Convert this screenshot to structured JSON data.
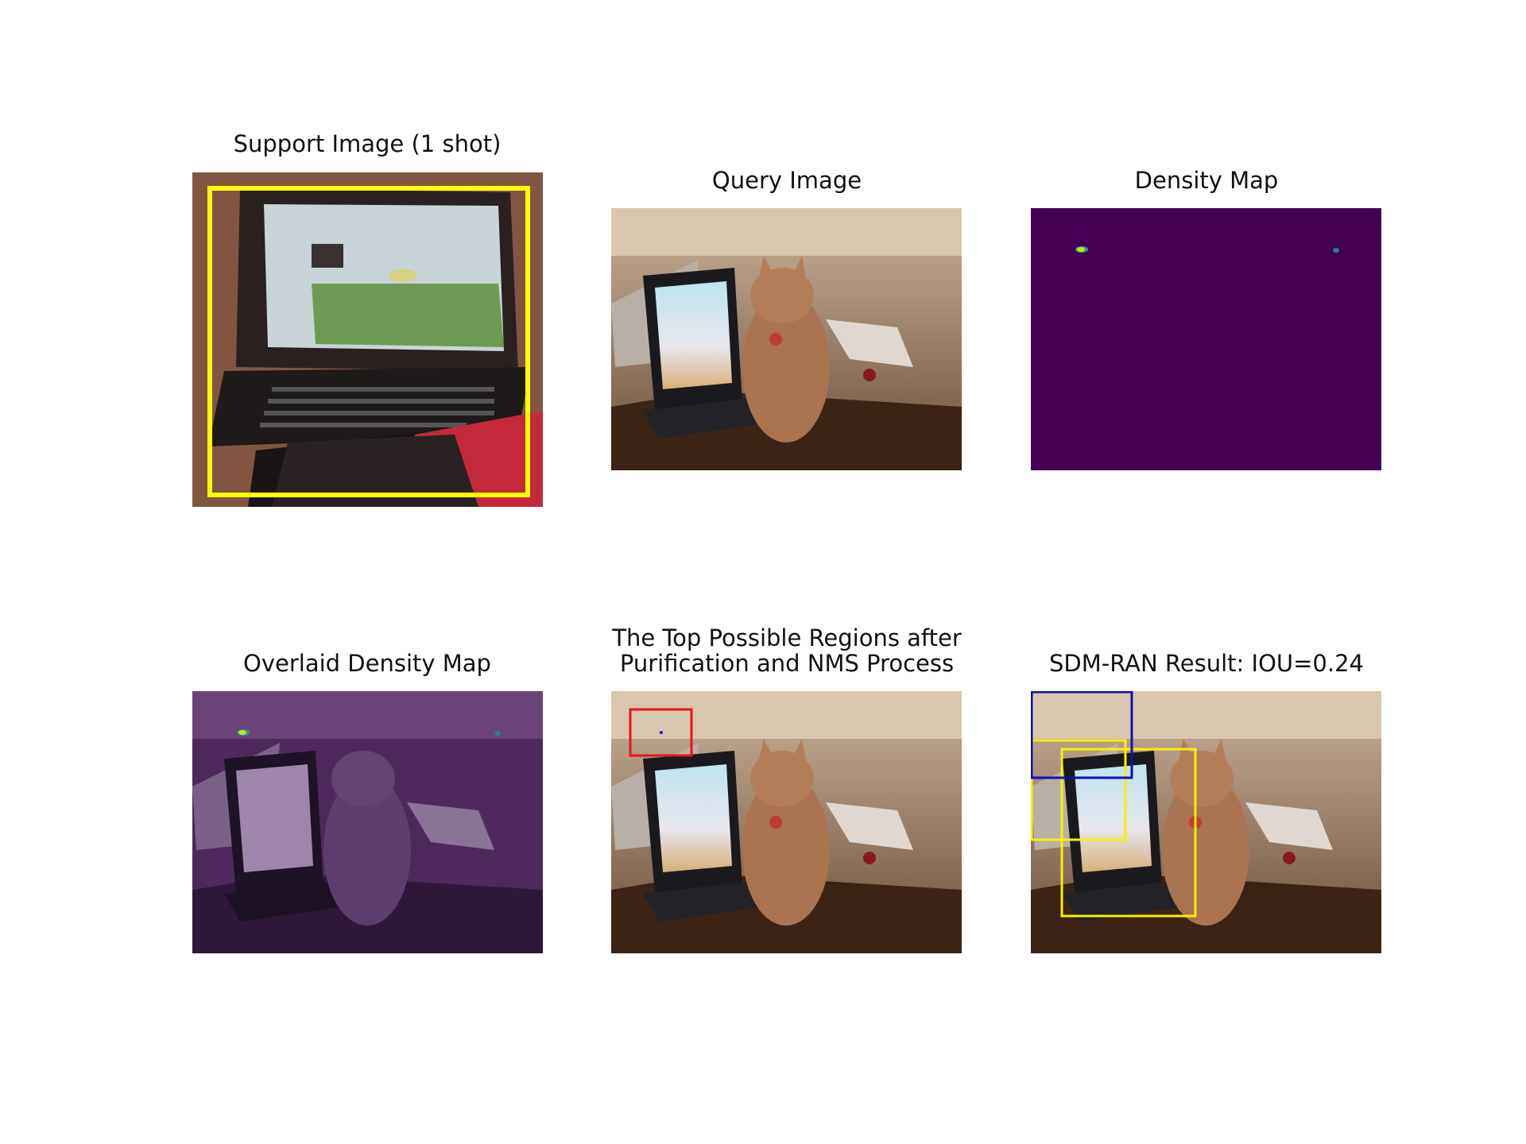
{
  "figure": {
    "panels": [
      {
        "id": "support",
        "title": [
          "Support Image (1 shot)"
        ]
      },
      {
        "id": "query",
        "title": [
          "Query Image"
        ]
      },
      {
        "id": "density",
        "title": [
          "Density Map"
        ]
      },
      {
        "id": "overlaid",
        "title": [
          "Overlaid Density Map"
        ]
      },
      {
        "id": "regions",
        "title": [
          "The Top Possible Regions after",
          "Purification and NMS Process"
        ]
      },
      {
        "id": "result",
        "title": [
          "SDM-RAN Result: IOU=0.24"
        ]
      }
    ],
    "colors": {
      "support_box": "#ffff00",
      "density_background": "#440154",
      "overlay_tint": "#5a2a6e",
      "region_box": "#e8141b",
      "predicted_box": "#1010b0",
      "ground_truth_box": "#f5f000"
    }
  }
}
